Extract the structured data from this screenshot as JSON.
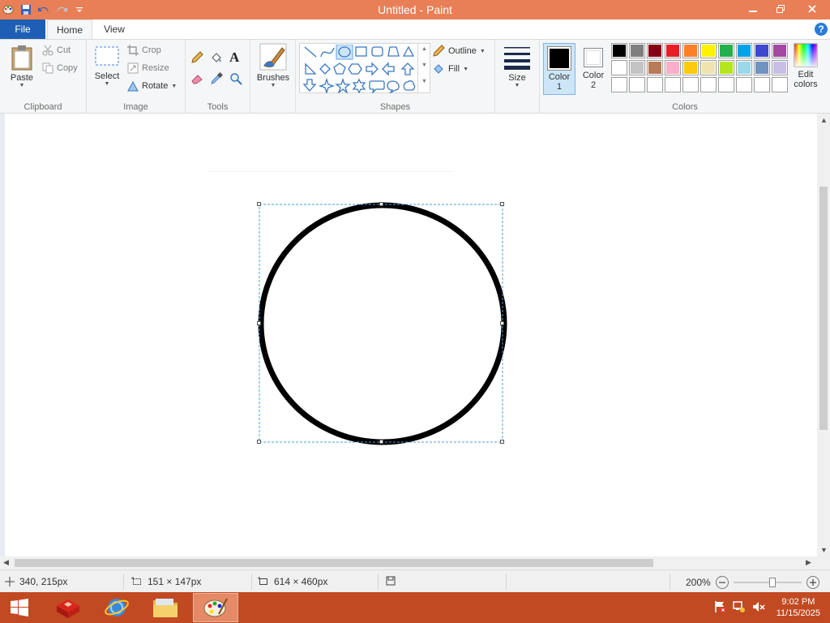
{
  "window": {
    "title": "Untitled - Paint"
  },
  "tabs": {
    "file": "File",
    "home": "Home",
    "view": "View"
  },
  "clipboard": {
    "paste": "Paste",
    "cut": "Cut",
    "copy": "Copy",
    "label": "Clipboard"
  },
  "image": {
    "select": "Select",
    "crop": "Crop",
    "resize": "Resize",
    "rotate": "Rotate",
    "label": "Image"
  },
  "tools": {
    "label": "Tools",
    "text_tool": "A"
  },
  "brushes": {
    "label": "Brushes"
  },
  "shapes": {
    "outline": "Outline",
    "fill": "Fill",
    "label": "Shapes"
  },
  "size": {
    "label": "Size"
  },
  "color1": {
    "line1": "Color",
    "line2": "1",
    "value": "#000000"
  },
  "color2": {
    "line1": "Color",
    "line2": "2",
    "value": "#ffffff"
  },
  "colors": {
    "label": "Colors",
    "edit_line1": "Edit",
    "edit_line2": "colors",
    "palette_row1": [
      "#000000",
      "#7f7f7f",
      "#880015",
      "#ed1c24",
      "#ff7f27",
      "#fff200",
      "#22b14c",
      "#00a2e8",
      "#3f48cc",
      "#a349a4"
    ],
    "palette_row2": [
      "#ffffff",
      "#c3c3c3",
      "#b97a57",
      "#ffaec9",
      "#ffc90e",
      "#efe4b0",
      "#b5e61d",
      "#99d9ea",
      "#7092be",
      "#c8bfe7"
    ],
    "palette_row3": [
      "#ffffff",
      "#ffffff",
      "#ffffff",
      "#ffffff",
      "#ffffff",
      "#ffffff",
      "#ffffff",
      "#ffffff",
      "#ffffff",
      "#ffffff"
    ]
  },
  "status": {
    "cursor_pos": "340, 215px",
    "selection_size": "151 × 147px",
    "canvas_size": "614 × 460px",
    "zoom": "200%"
  },
  "tray": {
    "time": "9:02 PM",
    "date": "11/15/2025"
  }
}
